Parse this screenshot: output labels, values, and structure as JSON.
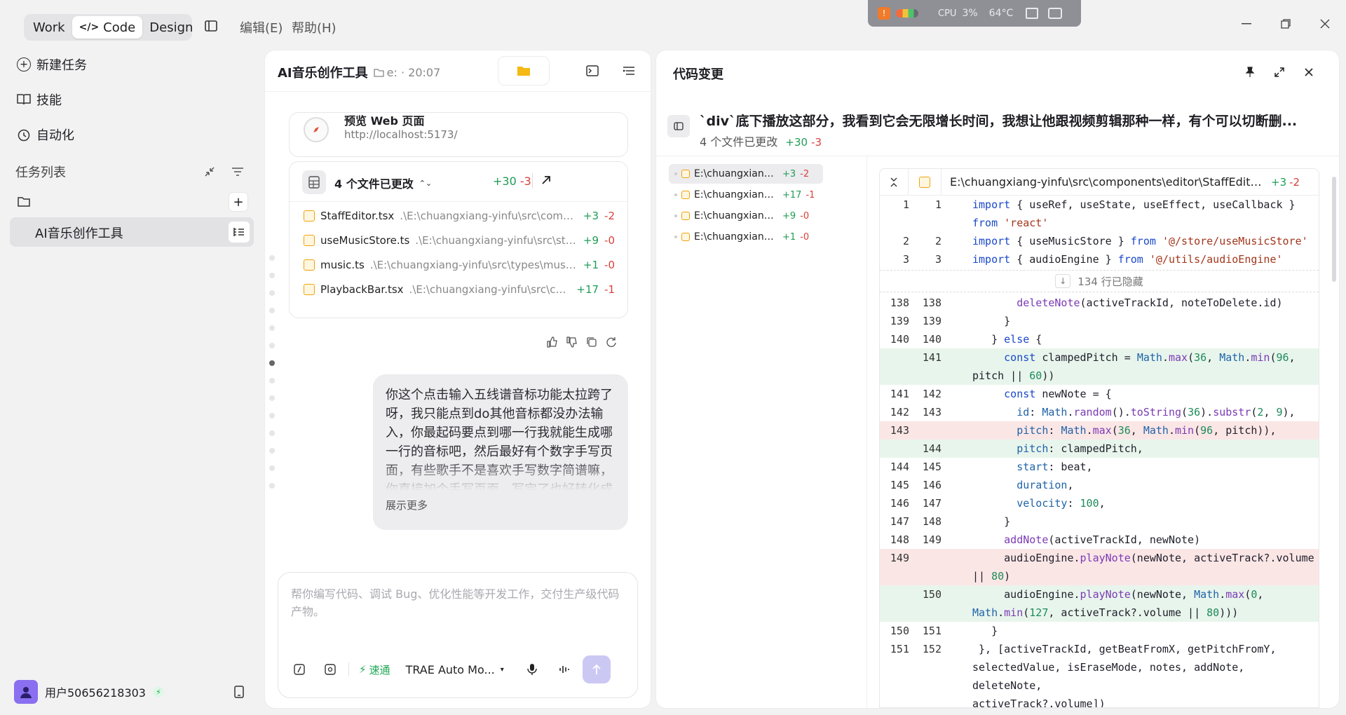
{
  "topbar": {
    "modes": [
      {
        "label": "Work"
      },
      {
        "label": "Code",
        "active": true
      },
      {
        "label": "Design"
      }
    ],
    "menus": [
      "编辑(E)",
      "帮助(H)"
    ],
    "tray": {
      "cpu_label": "CPU",
      "cpu_value": "3%",
      "temp": "64°C"
    }
  },
  "sidebar": {
    "items": [
      {
        "label": "新建任务",
        "icon": "new-task-icon"
      },
      {
        "label": "技能",
        "icon": "book-icon"
      },
      {
        "label": "自动化",
        "icon": "clock-icon"
      }
    ],
    "task_list_label": "任务列表",
    "task": "AI音乐创作工具",
    "user": "用户50656218303"
  },
  "chat": {
    "title": "AI音乐创作工具",
    "subtitle": "e: · 20:07",
    "preview": {
      "title": "预览 Web 页面",
      "url": "http://localhost:5173/"
    },
    "files_summary": {
      "label": "4 个文件已更改",
      "add": "+30",
      "del": "-3"
    },
    "files": [
      {
        "name": "StaffEditor.tsx",
        "path": ".\\E:\\chuangxiang-yinfu\\src\\components\\editor\\StaffEditor.tsx",
        "add": "+3",
        "del": "-2"
      },
      {
        "name": "useMusicStore.ts",
        "path": ".\\E:\\chuangxiang-yinfu\\src\\store\\useMusicStore.ts",
        "add": "+9",
        "del": "-0"
      },
      {
        "name": "music.ts",
        "path": ".\\E:\\chuangxiang-yinfu\\src\\types\\music.ts",
        "add": "+1",
        "del": "-0"
      },
      {
        "name": "PlaybackBar.tsx",
        "path": ".\\E:\\chuangxiang-yinfu\\src\\components\\PlaybackBar.tsx",
        "add": "+17",
        "del": "-1"
      }
    ],
    "bubble": "你这个点击输入五线谱音标功能太拉跨了呀，我只能点到do其他音标都没办法输入，你最起码要点到哪一行我就能生成哪一行的音标吧，然后最好有个数字手写页面，有些歌手不是喜欢手写数字简谱嘛，你直接加个手写页面，写完了也好转化成",
    "show_more": "展示更多",
    "input_placeholder": "帮你编写代码、调试 Bug、优化性能等开发工作，交付生产级代码产物。",
    "mode_label": "速通",
    "model": "TRAE Auto Mo..."
  },
  "code": {
    "title": "代码变更",
    "message": "`div`底下播放这部分，我看到它会无限增长时间，我想让他跟视频剪辑那种一样，有个可以切断删...",
    "count": "4 个文件已更改",
    "add": "+30",
    "del": "-3",
    "files": [
      {
        "path": "E:\\chuangxiang-yinfu\\src\\components\\editor\\StaffEditor.tsx",
        "add": "+3",
        "del": "-2",
        "selected": true
      },
      {
        "path": "E:\\chuangxiang-yinfu\\src\\components\\PlaybackBar.tsx",
        "add": "+17",
        "del": "-1"
      },
      {
        "path": "E:\\chuangxiang-yinfu\\src\\store\\useMusicStore.ts",
        "add": "+9",
        "del": "-0"
      },
      {
        "path": "E:\\chuangxiang-yinfu\\src\\types\\music.ts",
        "add": "+1",
        "del": "-0"
      }
    ],
    "diff_file": "E:\\chuangxiang-yinfu\\src\\components\\editor\\StaffEditor.tsx",
    "diff_add": "+3",
    "diff_del": "-2",
    "hidden": "134 行已隐藏"
  }
}
